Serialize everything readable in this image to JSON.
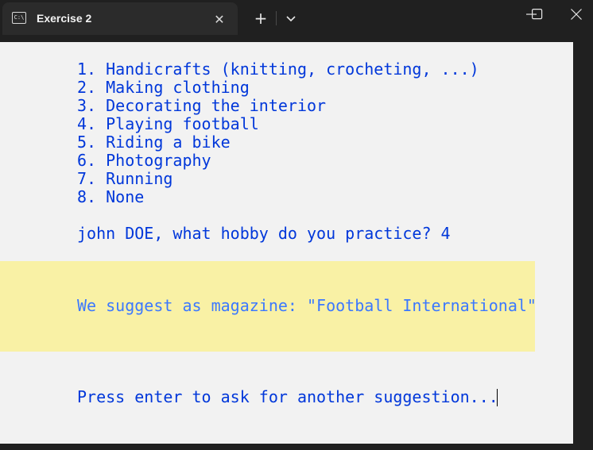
{
  "window": {
    "tab_title": "Exercise 2",
    "tab_icon": "terminal-icon",
    "new_tab_label": "+",
    "close_tab_label": "✕"
  },
  "terminal": {
    "menu": [
      "1. Handicrafts (knitting, crocheting, ...)",
      "2. Making clothing",
      "3. Decorating the interior",
      "4. Playing football",
      "5. Riding a bike",
      "6. Photography",
      "7. Running",
      "8. None"
    ],
    "prompt": "john DOE, what hobby do you practice? 4",
    "suggestion": "We suggest as magazine: \"Football International\"",
    "continue_prompt": "Press enter to ask for another suggestion..."
  },
  "colors": {
    "background": "#f2f2f2",
    "text_blue": "#0037da",
    "suggest_blue": "#3b78ff",
    "highlight": "#f9f1a5",
    "titlebar": "#202020"
  }
}
